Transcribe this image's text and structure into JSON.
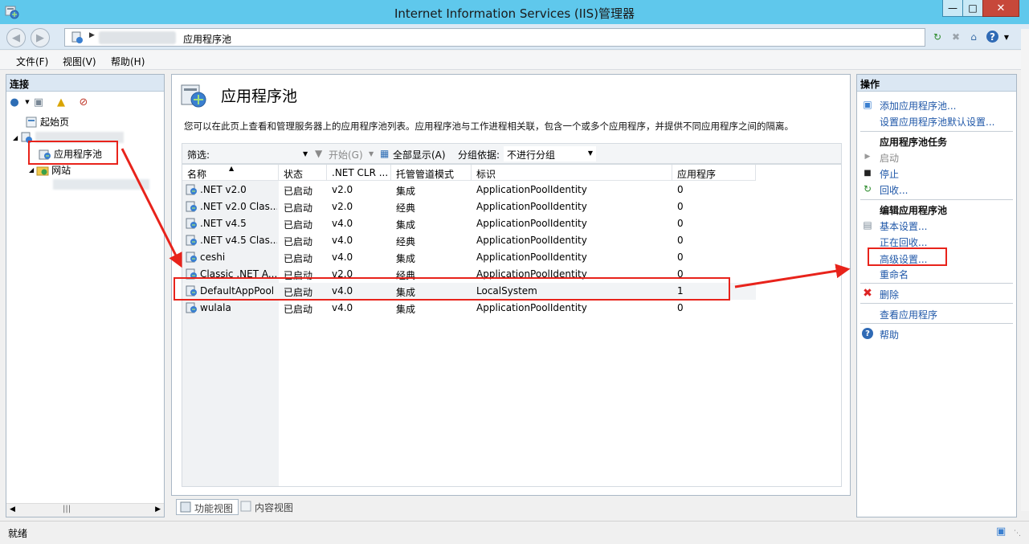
{
  "window": {
    "title": "Internet Information Services (IIS)管理器"
  },
  "address": {
    "crumb": "应用程序池"
  },
  "menu": {
    "items": [
      "文件(F)",
      "视图(V)",
      "帮助(H)"
    ]
  },
  "connections": {
    "header": "连接",
    "start_page": "起始页",
    "app_pools": "应用程序池",
    "sites": "网站"
  },
  "main": {
    "title": "应用程序池",
    "description": "您可以在此页上查看和管理服务器上的应用程序池列表。应用程序池与工作进程相关联，包含一个或多个应用程序，并提供不同应用程序之间的隔离。",
    "filter": {
      "label": "筛选:",
      "start_label": "开始(G)",
      "show_all_label": "全部显示(A)",
      "group_label": "分组依据:",
      "group_value": "不进行分组"
    },
    "columns": [
      "名称",
      "状态",
      ".NET CLR ...",
      "托管管道模式",
      "标识",
      "应用程序"
    ],
    "rows": [
      {
        "name": ".NET v2.0",
        "status": "已启动",
        "clr": "v2.0",
        "pipeline": "集成",
        "identity": "ApplicationPoolIdentity",
        "apps": "0"
      },
      {
        "name": ".NET v2.0 Clas...",
        "status": "已启动",
        "clr": "v2.0",
        "pipeline": "经典",
        "identity": "ApplicationPoolIdentity",
        "apps": "0"
      },
      {
        "name": ".NET v4.5",
        "status": "已启动",
        "clr": "v4.0",
        "pipeline": "集成",
        "identity": "ApplicationPoolIdentity",
        "apps": "0"
      },
      {
        "name": ".NET v4.5 Clas...",
        "status": "已启动",
        "clr": "v4.0",
        "pipeline": "经典",
        "identity": "ApplicationPoolIdentity",
        "apps": "0"
      },
      {
        "name": "ceshi",
        "status": "已启动",
        "clr": "v4.0",
        "pipeline": "集成",
        "identity": "ApplicationPoolIdentity",
        "apps": "0"
      },
      {
        "name": "Classic .NET A...",
        "status": "已启动",
        "clr": "v2.0",
        "pipeline": "经典",
        "identity": "ApplicationPoolIdentity",
        "apps": "0"
      },
      {
        "name": "DefaultAppPool",
        "status": "已启动",
        "clr": "v4.0",
        "pipeline": "集成",
        "identity": "LocalSystem",
        "apps": "1"
      },
      {
        "name": "wulala",
        "status": "已启动",
        "clr": "v4.0",
        "pipeline": "集成",
        "identity": "ApplicationPoolIdentity",
        "apps": "0"
      }
    ]
  },
  "view_tabs": {
    "features": "功能视图",
    "content": "内容视图"
  },
  "actions": {
    "header": "操作",
    "add_pool": "添加应用程序池...",
    "set_defaults": "设置应用程序池默认设置...",
    "tasks_header": "应用程序池任务",
    "start": "启动",
    "stop": "停止",
    "recycle": "回收...",
    "edit_header": "编辑应用程序池",
    "basic_settings": "基本设置...",
    "recycling": "正在回收...",
    "advanced_settings": "高级设置...",
    "rename": "重命名",
    "delete": "删除",
    "view_apps": "查看应用程序",
    "help": "帮助"
  },
  "status": {
    "text": "就绪"
  },
  "colors": {
    "titlebar": "#5fc8ec",
    "link": "#1f57a8",
    "annotation": "#e8231b"
  }
}
